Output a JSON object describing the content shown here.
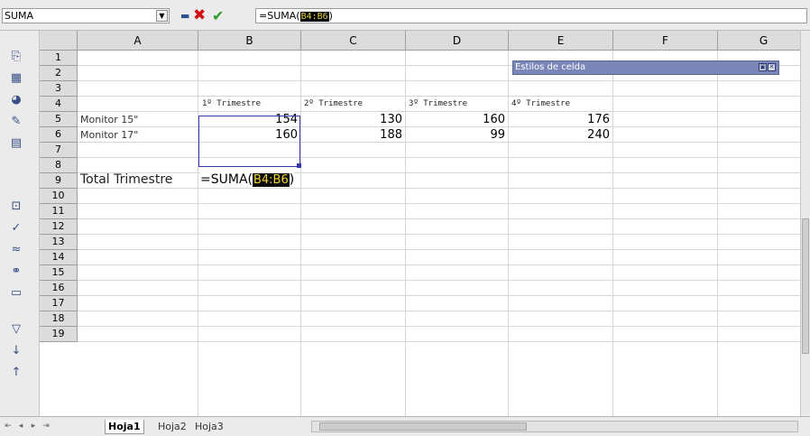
{
  "formula_bar": {
    "name_box": "SUMA",
    "formula_prefix": "=SUMA(",
    "formula_ref": "B4:B6",
    "formula_suffix": ")"
  },
  "icons": {
    "name_dropdown": "chevron-down-icon",
    "function": "function-icon",
    "cancel": "cancel-icon",
    "accept": "accept-icon"
  },
  "sheet": {
    "columns": [
      "A",
      "B",
      "C",
      "D",
      "E",
      "F",
      "G"
    ],
    "rows": [
      "1",
      "2",
      "3",
      "4",
      "5",
      "6",
      "7",
      "8",
      "9",
      "10",
      "11",
      "12",
      "13",
      "14",
      "15",
      "16",
      "17",
      "18",
      "19"
    ],
    "headers": [
      "1º Trimestre",
      "2º Trimestre",
      "3º Trimestre",
      "4º Trimestre"
    ],
    "row4": {
      "label": "Monitor 15\"",
      "values": [
        "154",
        "130",
        "160",
        "176"
      ]
    },
    "row5": {
      "label": "Monitor 17\"",
      "values": [
        "160",
        "188",
        "99",
        "240"
      ]
    },
    "total_label": "Total Trimestre",
    "editing_cell": {
      "prefix": "=SUMA(",
      "ref": "B4:B6",
      "suffix": ")"
    }
  },
  "styles_panel": {
    "title": "Estilos de celda"
  },
  "tabs": [
    "Hoja1",
    "Hoja2",
    "Hoja3"
  ]
}
